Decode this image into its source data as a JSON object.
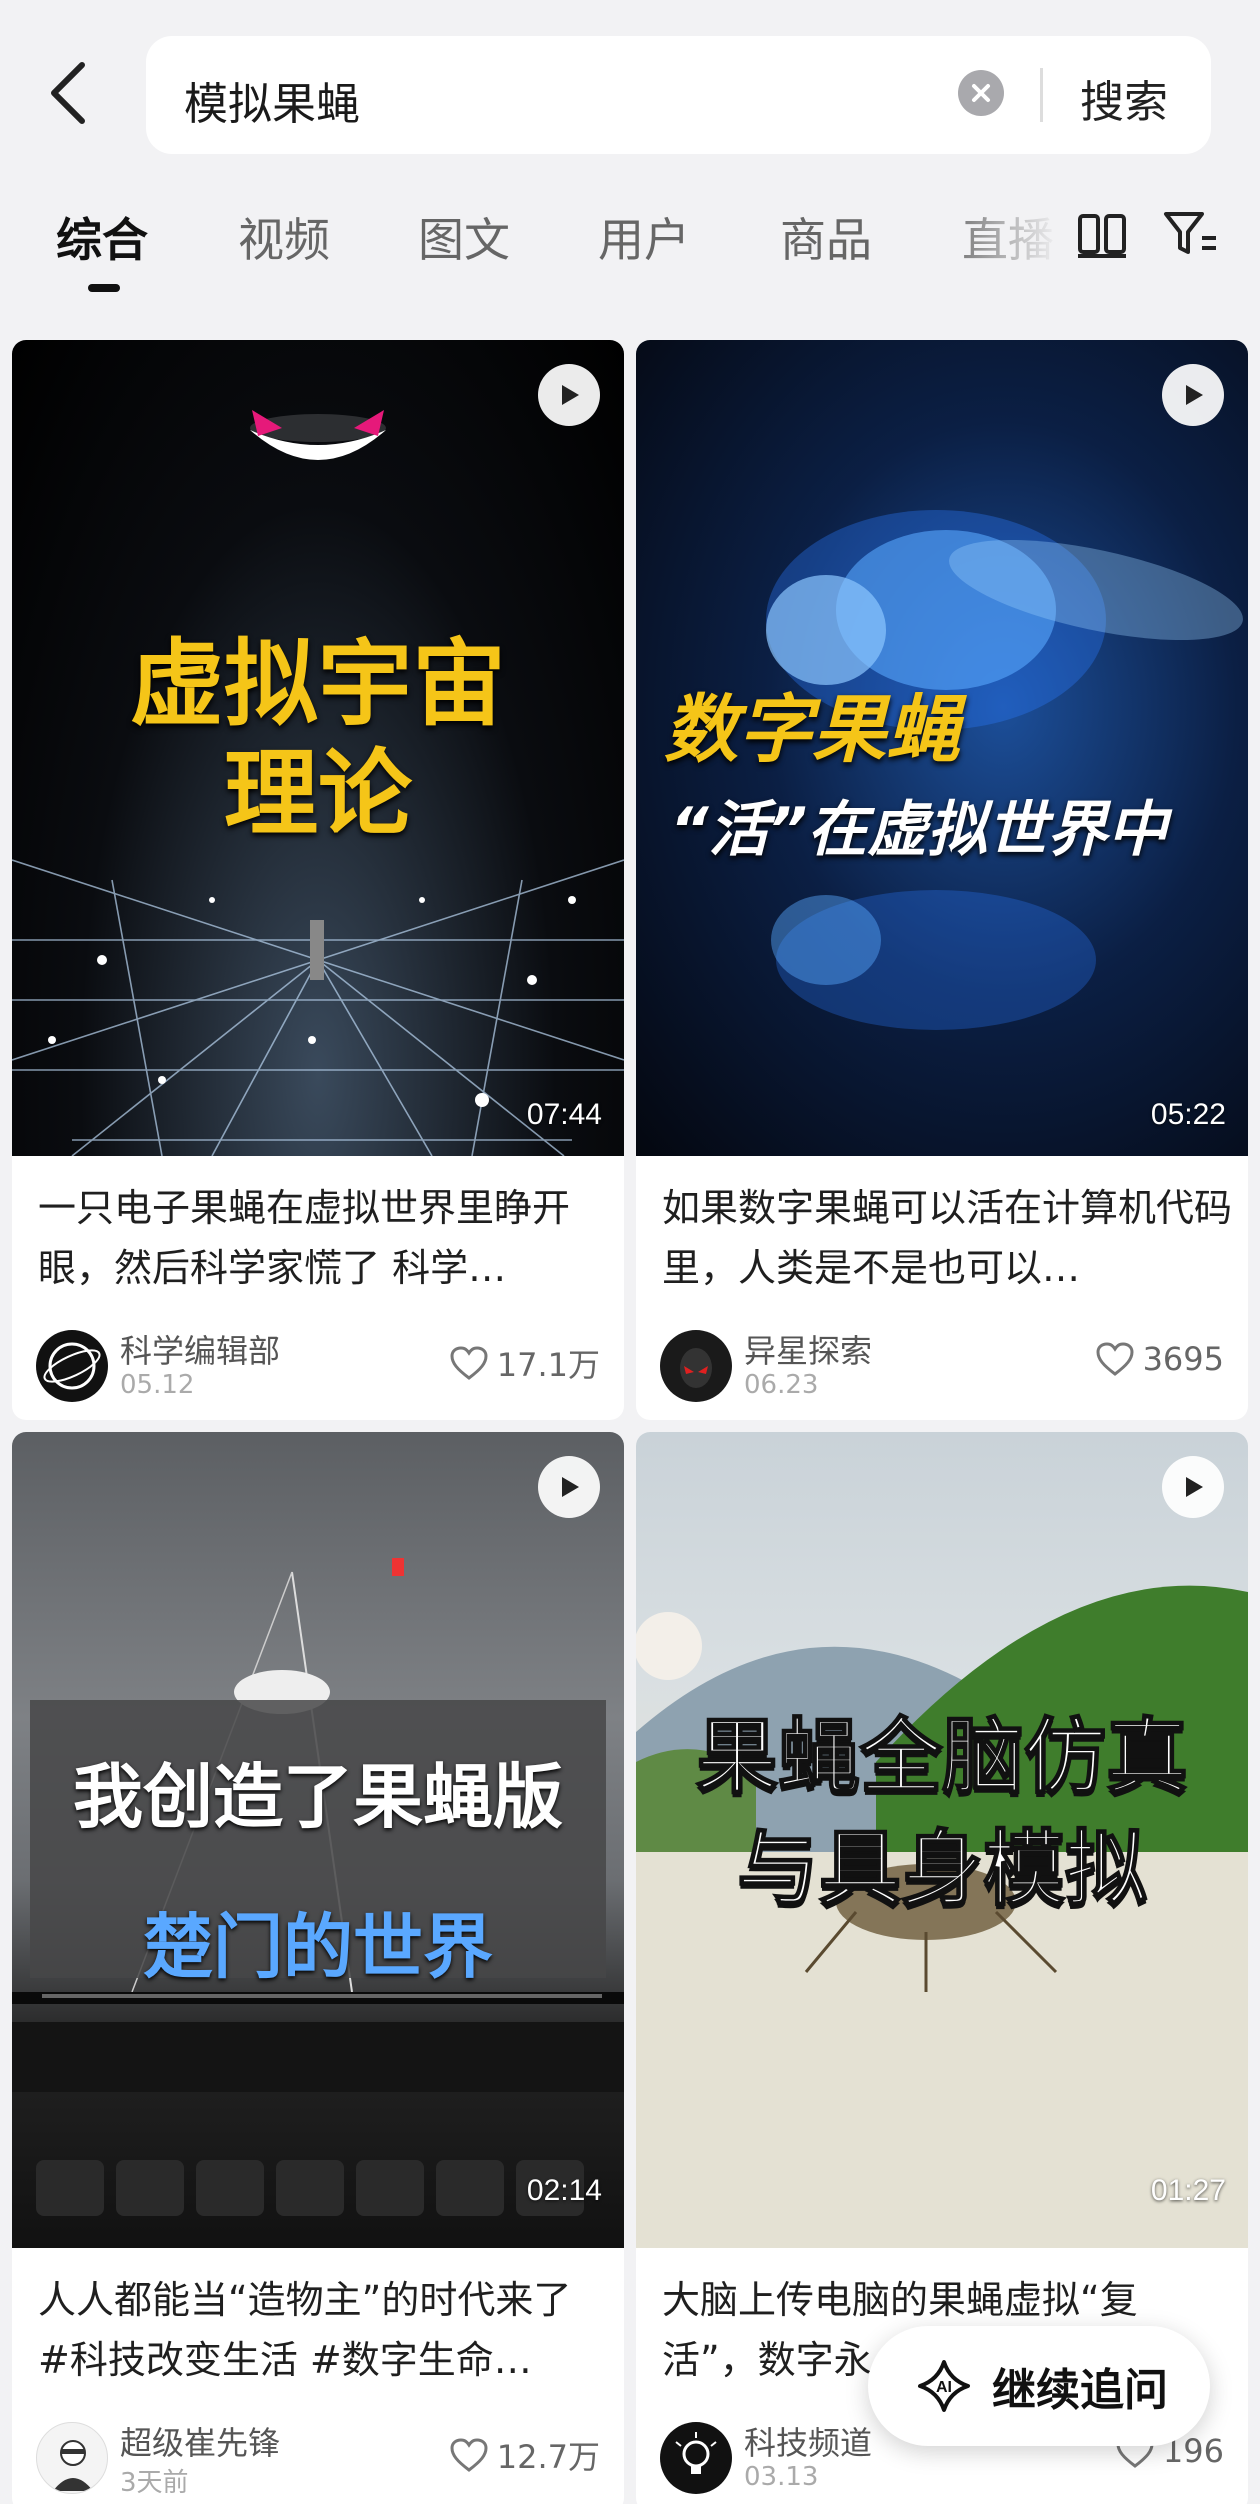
{
  "search": {
    "query": "模拟果蝇",
    "button_label": "搜索"
  },
  "tabs": [
    {
      "label": "综合",
      "active": true
    },
    {
      "label": "视频"
    },
    {
      "label": "图文"
    },
    {
      "label": "用户"
    },
    {
      "label": "商品"
    },
    {
      "label": "直播"
    }
  ],
  "cards": [
    {
      "overlay": [
        "虚拟宇宙",
        "理论"
      ],
      "duration": "07:44",
      "title": "一只电子果蝇在虚拟世界里睁开眼，然后科学家慌了 科学…",
      "author": "科学编辑部",
      "date": "05.12",
      "likes": "17.1万"
    },
    {
      "overlay": [
        "数字果蝇",
        "“活”在虚拟世界中"
      ],
      "duration": "05:22",
      "title": "如果数字果蝇可以活在计算机代码里，人类是不是也可以…",
      "author": "异星探索",
      "date": "06.23",
      "likes": "3695"
    },
    {
      "overlay": [
        "我创造了果蝇版",
        "楚门的世界"
      ],
      "duration": "02:14",
      "title": "人人都能当“造物主”的时代来了 #科技改变生活 #数字生命…",
      "author": "超级崔先锋",
      "date": "3天前",
      "likes": "12.7万"
    },
    {
      "overlay": [
        "果蝇全脑仿真",
        "与具身模拟"
      ],
      "duration": "01:27",
      "title": "大脑上传电脑的果蝇虚拟“复活”，数字永…",
      "author": "科技频道",
      "date": "03.13",
      "likes": "196"
    }
  ],
  "fab": {
    "label": "继续追问",
    "icon": "ai-sparkle-icon"
  },
  "colors": {
    "background": "#f2f2f4",
    "yellow_text": "#f5c518",
    "blue_text": "#5aa8ff"
  }
}
